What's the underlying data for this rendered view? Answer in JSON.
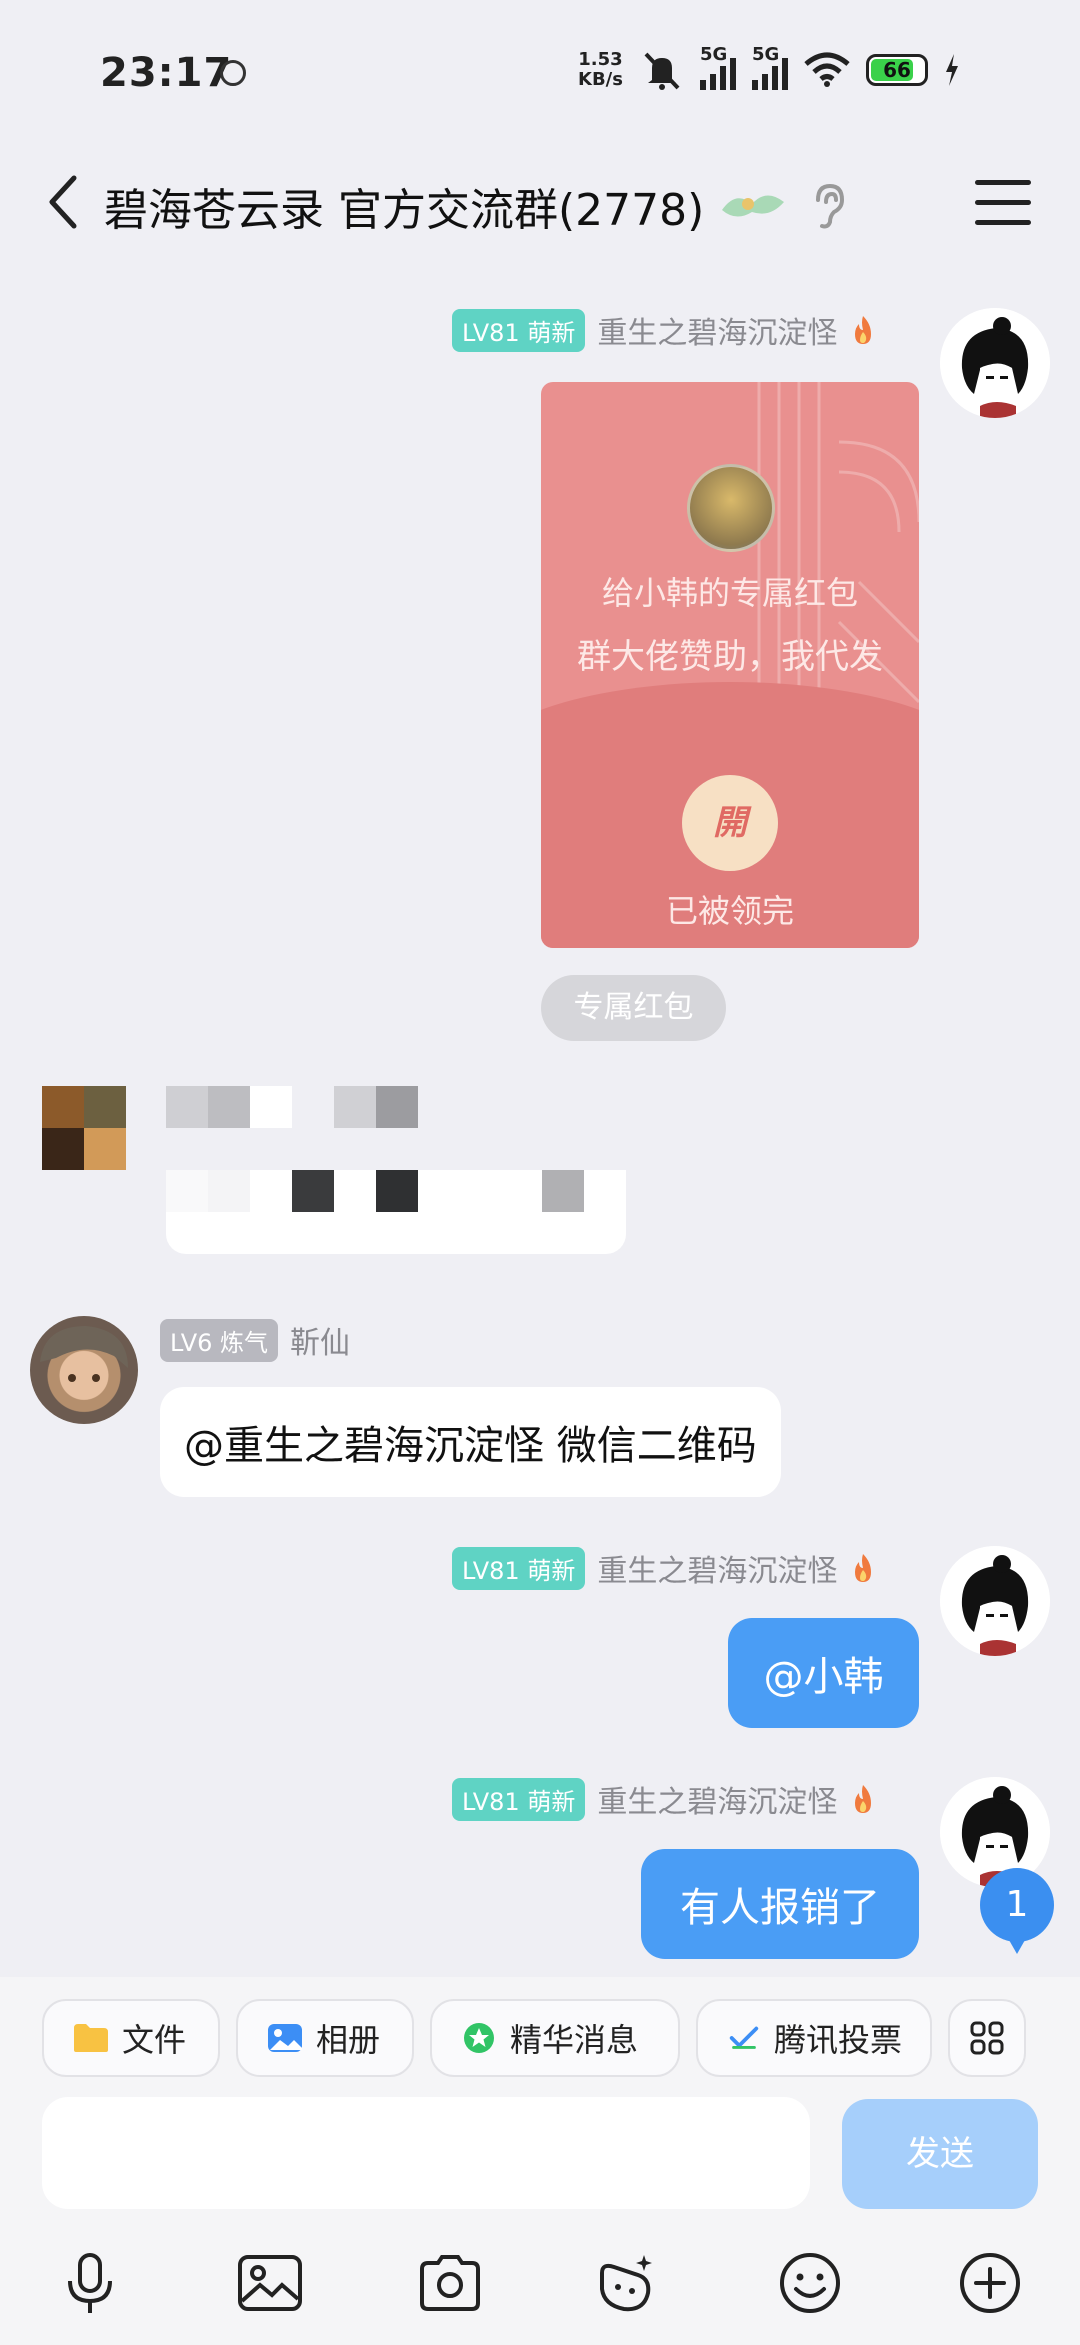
{
  "status_bar": {
    "time": "23:17",
    "speed_value": "1.53",
    "speed_unit": "KB/s",
    "net1": "5G",
    "net2": "5G",
    "battery": "66"
  },
  "header": {
    "title": "碧海苍云录 官方交流群(2778)",
    "back_icon": "chevron-left-icon",
    "menu_icon": "hamburger-menu-icon",
    "ear_icon": "ear-icon"
  },
  "messages": {
    "m1": {
      "level": "LV81 萌新",
      "name": "重生之碧海沉淀怪",
      "red_packet": {
        "line1": "给小韩的专属红包",
        "line2": "群大佬赞助，我代发",
        "open_label": "開",
        "status": "已被领完"
      },
      "tag": "专属红包"
    },
    "m3": {
      "level": "LV6 炼气",
      "name": "靳仙",
      "text": "@重生之碧海沉淀怪 微信二维码"
    },
    "m4": {
      "level": "LV81 萌新",
      "name": "重生之碧海沉淀怪",
      "text": "@小韩"
    },
    "m5": {
      "level": "LV81 萌新",
      "name": "重生之碧海沉淀怪",
      "text": "有人报销了"
    }
  },
  "unread_count": "1",
  "quickbar": {
    "file": "文件",
    "album": "相册",
    "essence": "精华消息",
    "vote": "腾讯投票"
  },
  "composer": {
    "placeholder": "",
    "send": "发送"
  },
  "colors": {
    "accent_blue": "#4a9df5",
    "level_green": "#5fd3c4",
    "red_packet": "#e9908f"
  }
}
